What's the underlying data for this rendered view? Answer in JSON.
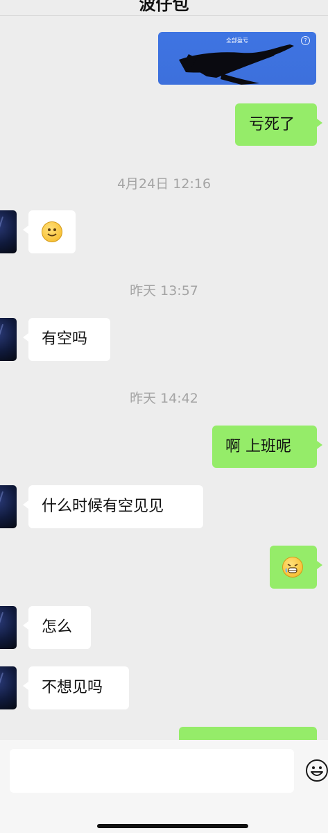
{
  "header": {
    "title": "波仔包"
  },
  "share_card": {
    "caption": "全部盈亏",
    "help_label": "?"
  },
  "messages": [
    {
      "side": "out",
      "text": "亏死了"
    },
    {
      "type": "timestamp",
      "text": "4月24日 12:16"
    },
    {
      "side": "in",
      "emoji": "smile"
    },
    {
      "type": "timestamp",
      "text": "昨天 13:57"
    },
    {
      "side": "in",
      "text": "有空吗"
    },
    {
      "type": "timestamp",
      "text": "昨天 14:42"
    },
    {
      "side": "out",
      "text": "啊 上班呢"
    },
    {
      "side": "in",
      "text": "什么时候有空见见"
    },
    {
      "side": "out",
      "emoji": "grin"
    },
    {
      "side": "in",
      "text": "怎么"
    },
    {
      "side": "in",
      "text": "不想见吗"
    }
  ],
  "colors": {
    "background": "#ededed",
    "outgoing_bubble": "#95ec69",
    "incoming_bubble": "#ffffff",
    "card_blue": "#3d70dc",
    "timestamp_text": "#a4a4a4"
  },
  "input_bar": {
    "emoji_button_icon": "emoji-smile-icon"
  }
}
